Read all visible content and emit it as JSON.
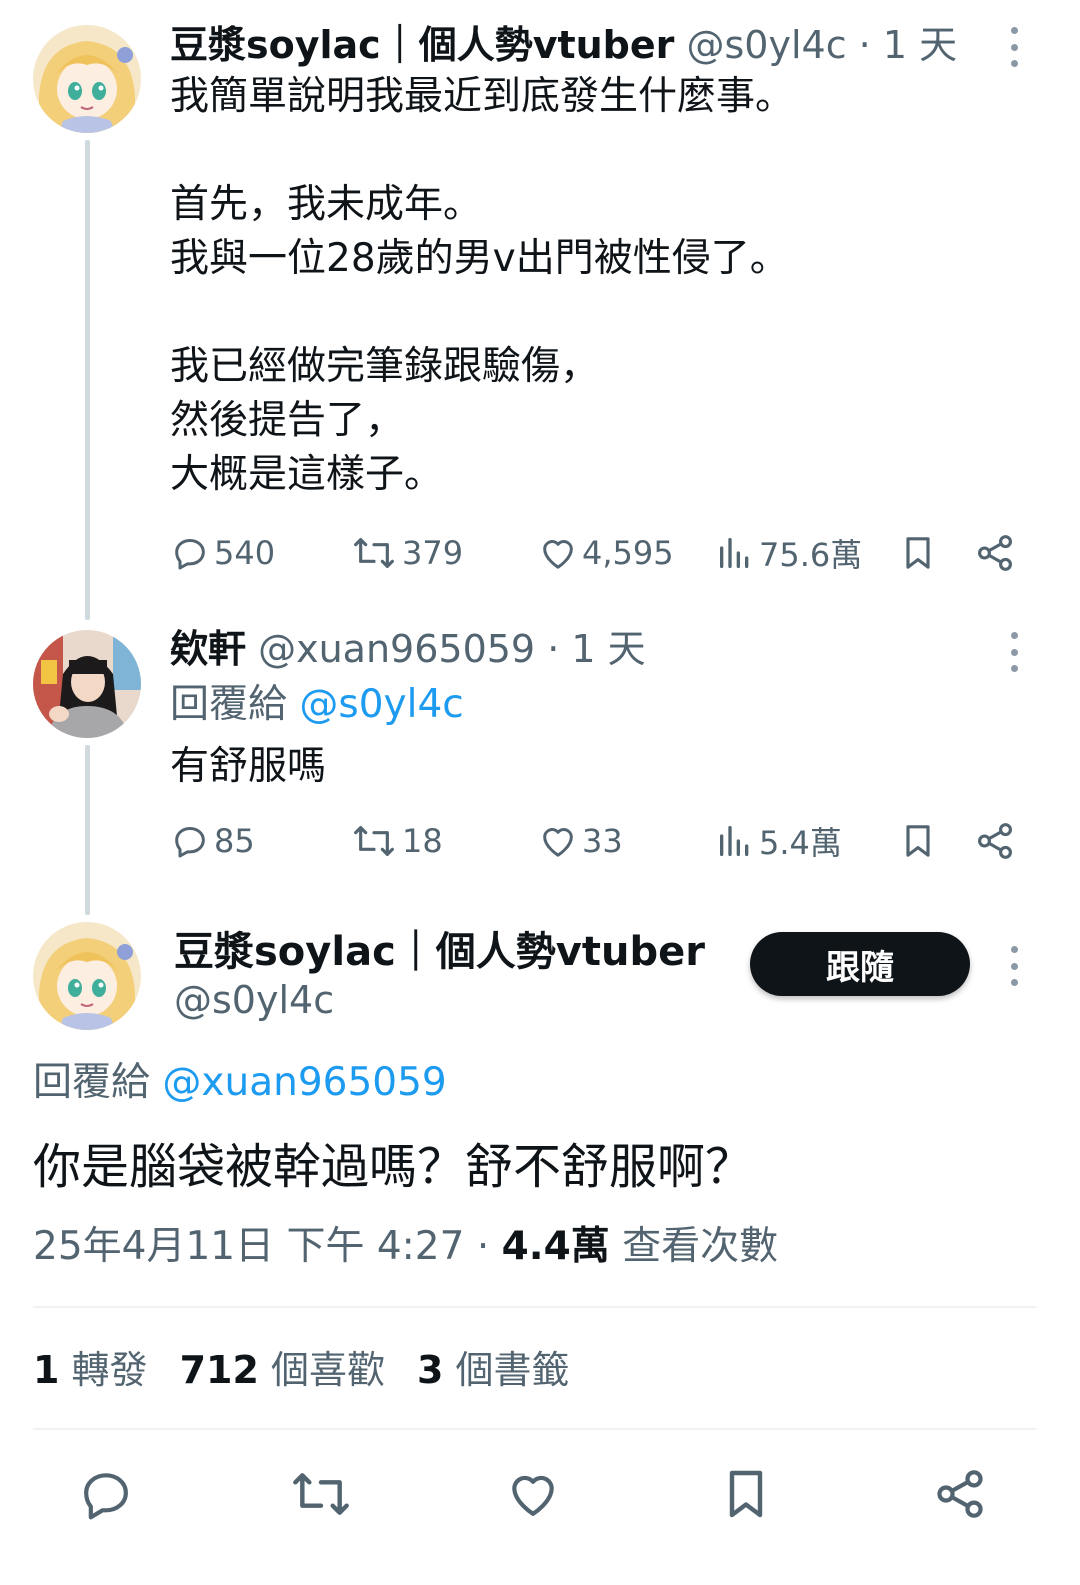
{
  "tweet1": {
    "name": "豆漿soylac｜個人勢vtuber",
    "handle_time": "@s0yl4c · 1 天",
    "text": "我簡單說明我最近到底發生什麼事。\n\n首先，我未成年。\n我與一位28歲的男v出門被性侵了。\n\n我已經做完筆錄跟驗傷，\n然後提告了，\n大概是這樣子。",
    "replies": "540",
    "retweets": "379",
    "likes": "4,595",
    "views": "75.6萬"
  },
  "tweet2": {
    "name": "欸軒",
    "handle_time": "@xuan965059 · 1 天",
    "reply_prefix": "回覆給",
    "reply_mention": "@s0yl4c",
    "text": "有舒服嗎",
    "replies": "85",
    "retweets": "18",
    "likes": "33",
    "views": "5.4萬"
  },
  "main": {
    "name": "豆漿soylac｜個人勢vtuber",
    "handle": "@s0yl4c",
    "follow_label": "跟隨",
    "reply_prefix": "回覆給",
    "reply_mention": "@xuan965059",
    "text": "你是腦袋被幹過嗎？舒不舒服啊？",
    "timestamp": "25年4月11日 下午 4:27 ·",
    "views_count": "4.4萬",
    "views_label": "查看次數",
    "retweets_count": "1",
    "retweets_label": "轉發",
    "likes_count": "712",
    "likes_label": "個喜歡",
    "bookmarks_count": "3",
    "bookmarks_label": "個書籤"
  },
  "icons": {
    "reply": "reply-icon",
    "retweet": "retweet-icon",
    "like": "heart-icon",
    "views": "views-icon",
    "bookmark": "bookmark-icon",
    "share": "share-icon",
    "more": "more-icon"
  },
  "colors": {
    "text": "#0f1419",
    "secondary": "#536471",
    "link": "#1d9bf0",
    "thread_line": "#cfd9de",
    "button": "#0f1419"
  }
}
